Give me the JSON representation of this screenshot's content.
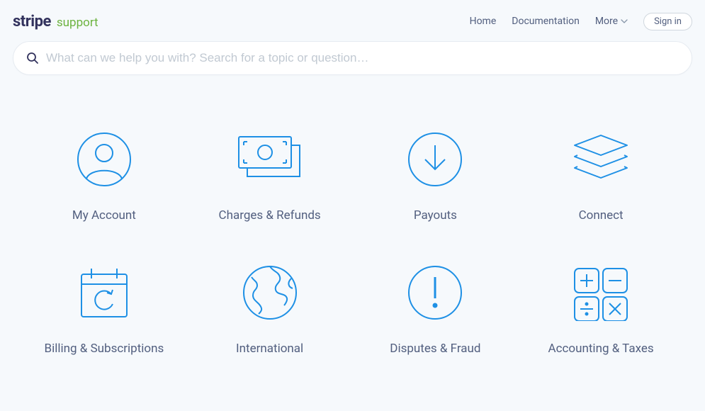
{
  "header": {
    "logo_stripe": "stripe",
    "logo_support": "support",
    "nav": {
      "home": "Home",
      "documentation": "Documentation",
      "more": "More",
      "sign_in": "Sign in"
    }
  },
  "search": {
    "placeholder": "What can we help you with? Search for a topic or question…",
    "value": ""
  },
  "colors": {
    "icon_stroke": "#1e90e5",
    "text": "#525f7f"
  },
  "categories": [
    {
      "id": "my-account",
      "label": "My Account",
      "icon": "user-circle-icon"
    },
    {
      "id": "charges-refunds",
      "label": "Charges & Refunds",
      "icon": "cash-icon"
    },
    {
      "id": "payouts",
      "label": "Payouts",
      "icon": "download-circle-icon"
    },
    {
      "id": "connect",
      "label": "Connect",
      "icon": "layers-icon"
    },
    {
      "id": "billing-subscriptions",
      "label": "Billing & Subscriptions",
      "icon": "calendar-sync-icon"
    },
    {
      "id": "international",
      "label": "International",
      "icon": "globe-icon"
    },
    {
      "id": "disputes-fraud",
      "label": "Disputes & Fraud",
      "icon": "alert-circle-icon"
    },
    {
      "id": "accounting-taxes",
      "label": "Accounting & Taxes",
      "icon": "calculator-icon"
    }
  ]
}
